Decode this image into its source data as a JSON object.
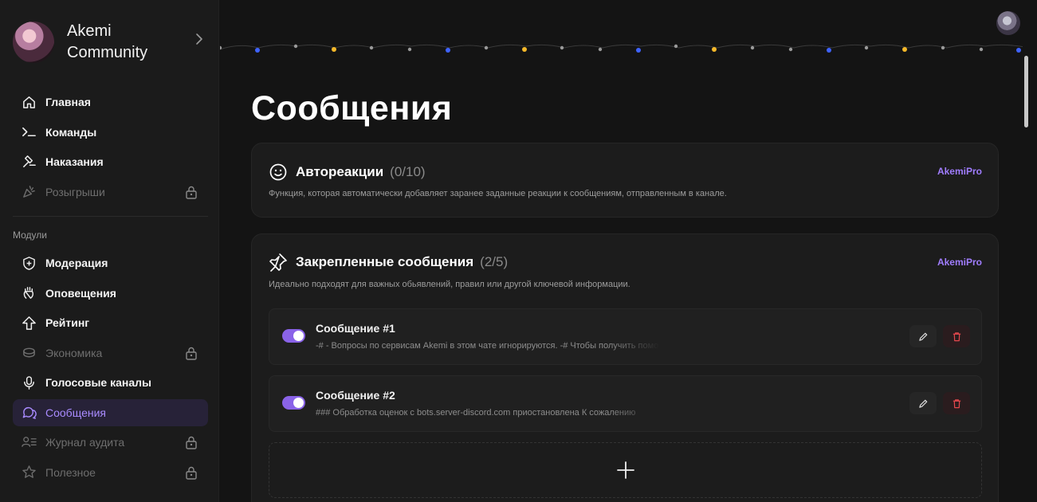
{
  "brand": {
    "name": "Akemi Community"
  },
  "sidebar": {
    "items": [
      {
        "label": "Главная",
        "icon": "home-icon",
        "locked": false
      },
      {
        "label": "Команды",
        "icon": "terminal-icon",
        "locked": false
      },
      {
        "label": "Наказания",
        "icon": "gavel-icon",
        "locked": false
      },
      {
        "label": "Розыгрыши",
        "icon": "party-popper-icon",
        "locked": true
      }
    ],
    "modules_label": "Модули",
    "modules": [
      {
        "label": "Модерация",
        "icon": "shield-plus-icon",
        "locked": false
      },
      {
        "label": "Оповещения",
        "icon": "waving-hand-icon",
        "locked": false
      },
      {
        "label": "Рейтинг",
        "icon": "arrow-up-icon",
        "locked": false
      },
      {
        "label": "Экономика",
        "icon": "coins-icon",
        "locked": true
      },
      {
        "label": "Голосовые каналы",
        "icon": "microphone-icon",
        "locked": false
      },
      {
        "label": "Сообщения",
        "icon": "chat-bubbles-icon",
        "locked": false,
        "active": true
      },
      {
        "label": "Журнал аудита",
        "icon": "user-list-icon",
        "locked": true
      },
      {
        "label": "Полезное",
        "icon": "star-icon",
        "locked": true
      }
    ]
  },
  "main": {
    "title": "Сообщения",
    "autoreactions": {
      "title": "Автореакции",
      "count": "(0/10)",
      "badge": "AkemiPro",
      "description": "Функция, которая автоматически добавляет заранее заданные реакции к сообщениям, отправленным в канале."
    },
    "pinned": {
      "title": "Закрепленные сообщения",
      "count": "(2/5)",
      "badge": "AkemiPro",
      "description": "Идеально подходят для важных обьявлений, правил или другой ключевой информации.",
      "messages": [
        {
          "title": "Сообщение #1",
          "preview": "-# - Вопросы по сервисам Akemi в этом чате игнорируются. -# Чтобы получить помощь",
          "enabled": true
        },
        {
          "title": "Сообщение #2",
          "preview": "### Обработка оценок с bots.server-discord.com приостановлена К сожалению",
          "enabled": true
        }
      ]
    }
  },
  "colors": {
    "accent": "#8a63e8",
    "active_text": "#a98bff",
    "background": "#141414",
    "sidebar": "#1b1b1b",
    "card": "#1c1c1c",
    "danger": "#e5484d"
  }
}
